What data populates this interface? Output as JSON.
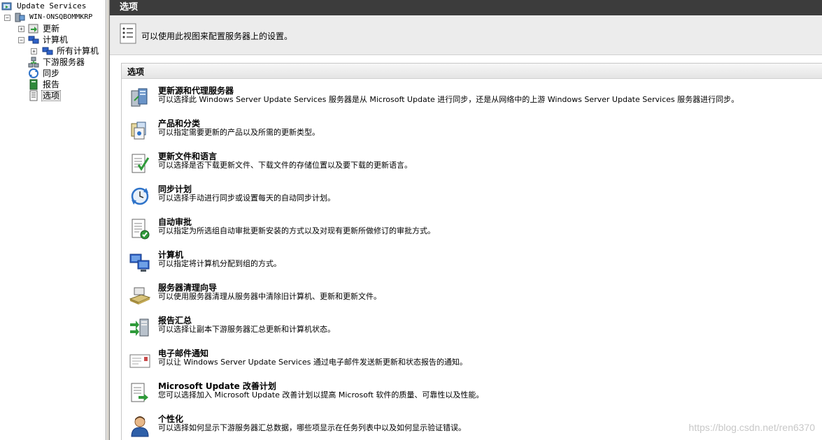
{
  "tree": {
    "root": "Update Services",
    "server": "WIN-ONSQBOMMKRP",
    "updates": "更新",
    "computers": "计算机",
    "all_computers": "所有计算机",
    "downstream": "下游服务器",
    "sync": "同步",
    "reports": "报告",
    "options": "选项"
  },
  "main": {
    "title": "选项",
    "intro": "可以使用此视图来配置服务器上的设置。",
    "panel_title": "选项",
    "options": [
      {
        "title": "更新源和代理服务器",
        "desc": "可以选择此 Windows Server Update Services 服务器是从 Microsoft Update 进行同步，还是从网络中的上游 Windows Server Update Services 服务器进行同步。",
        "icon": "server-proxy-icon"
      },
      {
        "title": "产品和分类",
        "desc": "可以指定需要更新的产品以及所需的更新类型。",
        "icon": "products-icon"
      },
      {
        "title": "更新文件和语言",
        "desc": "可以选择是否下载更新文件、下载文件的存储位置以及要下载的更新语言。",
        "icon": "update-files-icon"
      },
      {
        "title": "同步计划",
        "desc": "可以选择手动进行同步或设置每天的自动同步计划。",
        "icon": "sync-schedule-icon"
      },
      {
        "title": "自动审批",
        "desc": "可以指定为所选组自动审批更新安装的方式以及对现有更新所做修订的审批方式。",
        "icon": "auto-approval-icon"
      },
      {
        "title": "计算机",
        "desc": "可以指定将计算机分配到组的方式。",
        "icon": "computers-icon"
      },
      {
        "title": "服务器清理向导",
        "desc": "可以使用服务器清理从服务器中清除旧计算机、更新和更新文件。",
        "icon": "cleanup-wizard-icon"
      },
      {
        "title": "报告汇总",
        "desc": "可以选择让副本下游服务器汇总更新和计算机状态。",
        "icon": "reporting-rollup-icon"
      },
      {
        "title": "电子邮件通知",
        "desc": "可以让 Windows Server Update Services 通过电子邮件发送新更新和状态报告的通知。",
        "icon": "email-notification-icon"
      },
      {
        "title": "Microsoft Update 改善计划",
        "desc": "您可以选择加入 Microsoft Update 改善计划以提高 Microsoft 软件的质量、可靠性以及性能。",
        "icon": "improvement-program-icon"
      },
      {
        "title": "个性化",
        "desc": "可以选择如何显示下游服务器汇总数据，哪些项显示在任务列表中以及如何显示验证错误。",
        "icon": "personalization-icon"
      }
    ]
  },
  "watermark": "https://blog.csdn.net/ren6370"
}
